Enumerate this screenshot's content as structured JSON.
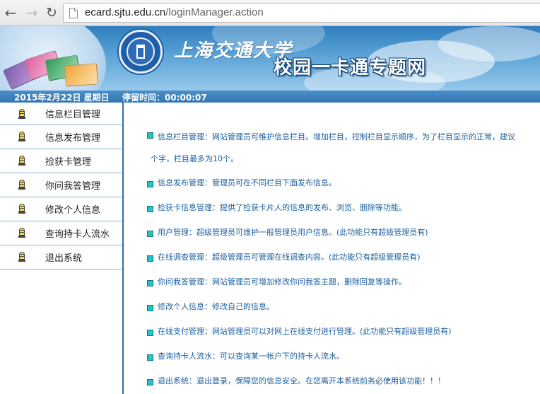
{
  "browser": {
    "url_host": "ecard.sjtu.edu.cn",
    "url_path": "/loginManager.action",
    "back_icon": "←",
    "forward_icon": "→",
    "reload_icon": "↻"
  },
  "banner": {
    "school_name_calligraphy": "上海交通大学",
    "site_title": "校园一卡通专题网"
  },
  "status": {
    "date": "2015年2月22日 星期日",
    "stay_time": "停留时间：00:00:07"
  },
  "sidebar": {
    "items": [
      {
        "label": "信息栏目管理"
      },
      {
        "label": "信息发布管理"
      },
      {
        "label": "捡获卡管理"
      },
      {
        "label": "你问我答管理"
      },
      {
        "label": "修改个人信息"
      },
      {
        "label": "查询持卡人流水"
      },
      {
        "label": "退出系统"
      }
    ]
  },
  "content": {
    "items": [
      {
        "text": "信息栏目管理：网站管理员可维护信息栏目。增加栏目，控制栏目显示顺序，为了栏目显示的正常，建议",
        "cont": "个字，栏目最多为10个。"
      },
      {
        "text": "信息发布管理：管理员可在不同栏目下面发布信息。"
      },
      {
        "text": "捡获卡信息管理：提供了捡获卡片人的信息的发布、浏览、删除等功能。"
      },
      {
        "text": "用户管理：超级管理员可维护一般管理员用户信息。(此功能只有超级管理员有)"
      },
      {
        "text": "在线调查管理：超级管理员可管理在线调查内容。(此功能只有超级管理员有)"
      },
      {
        "text": "你问我答管理：网站管理员可增加修改你问我答主题，删除回复等操作。"
      },
      {
        "text": "修改个人信息：修改自己的信息。"
      },
      {
        "text": "在线支付管理：网站管理员可以对网上在线支付进行管理。(此功能只有超级管理员有)"
      },
      {
        "text": "查询持卡人流水：可以查询某一帐户下的持卡人流水。"
      },
      {
        "text": "退出系统：退出登录，保障您的信息安全。在您离开本系统前务必使用该功能！！！"
      }
    ]
  }
}
